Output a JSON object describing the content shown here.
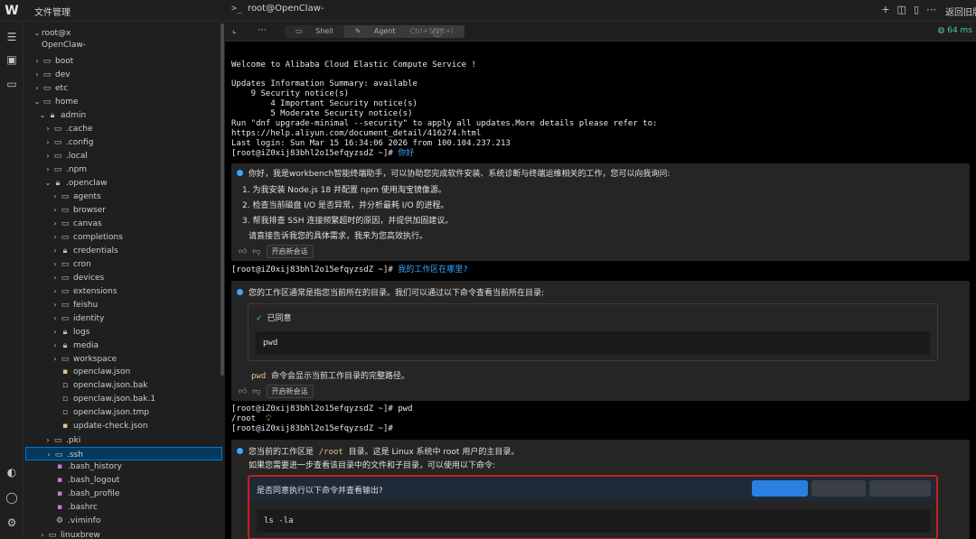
{
  "titlebar": {
    "app_title": "文件管理",
    "terminal_tab": "root@OpenClaw-",
    "back_label": "返回旧版"
  },
  "explorer": {
    "root_label": "root@x",
    "host_label": "OpenClaw-",
    "items": [
      {
        "label": "boot"
      },
      {
        "label": "dev"
      },
      {
        "label": "etc"
      },
      {
        "label": "home"
      },
      {
        "label": "admin"
      },
      {
        "label": ".cache"
      },
      {
        "label": ".config"
      },
      {
        "label": ".local"
      },
      {
        "label": ".npm"
      },
      {
        "label": ".openclaw"
      },
      {
        "label": "agents"
      },
      {
        "label": "browser"
      },
      {
        "label": "canvas"
      },
      {
        "label": "completions"
      },
      {
        "label": "credentials"
      },
      {
        "label": "cron"
      },
      {
        "label": "devices"
      },
      {
        "label": "extensions"
      },
      {
        "label": "feishu"
      },
      {
        "label": "identity"
      },
      {
        "label": "logs"
      },
      {
        "label": "media"
      },
      {
        "label": "workspace"
      },
      {
        "label": "openclaw.json"
      },
      {
        "label": "openclaw.json.bak"
      },
      {
        "label": "openclaw.json.bak.1"
      },
      {
        "label": "openclaw.json.tmp"
      },
      {
        "label": "update-check.json"
      },
      {
        "label": ".pki"
      },
      {
        "label": ".ssh"
      },
      {
        "label": ".bash_history"
      },
      {
        "label": ".bash_logout"
      },
      {
        "label": ".bash_profile"
      },
      {
        "label": ".bashrc"
      },
      {
        "label": ".viminfo"
      },
      {
        "label": "linuxbrew"
      }
    ]
  },
  "terminal": {
    "tabs": {
      "shell": "Shell",
      "agent": "Agent",
      "agent_kbd": "Ctrl+Shift+I"
    },
    "latency": "64 ms",
    "welcome": "Welcome to Alibaba Cloud Elastic Compute Service !",
    "updates": [
      "Updates Information Summary: available",
      "    9 Security notice(s)",
      "        4 Important Security notice(s)",
      "        5 Moderate Security notice(s)",
      "Run \"dnf upgrade-minimal --security\" to apply all updates.More details please refer to:",
      "https://help.aliyun.com/document_detail/416274.html",
      "Last login: Sun Mar 15 16:34:06 2026 from 100.104.237.213"
    ],
    "prompt": "[root@iZ0xij83bhl2o15efqyzsdZ ~]#",
    "cmd1": "你好",
    "cmd2": "我的工作区在哪里?",
    "cmd3": "pwd",
    "pwd_out": "/root",
    "ai1": {
      "intro": "你好，我是workbench智能终端助手，可以协助您完成软件安装、系统诊断与终端运维相关的工作，您可以向我询问:",
      "items": [
        "1. 为我安装 Node.js 18 并配置 npm 使用淘宝镜像源。",
        "2. 检查当前磁盘 I/O 是否异常，并分析最耗 I/O 的进程。",
        "3. 帮我排查 SSH 连接频繁超时的原因，并提供加固建议。"
      ],
      "outro": "请直接告诉我您的具体需求，我来为您高效执行。",
      "new_chat": "开启新会话"
    },
    "ai2": {
      "intro": "您的工作区通常是指您当前所在的目录。我们可以通过以下命令查看当前所在目录:",
      "agreed": "已同意",
      "code": "pwd",
      "note_code": "pwd",
      "note": "命令会显示当前工作目录的完整路径。",
      "new_chat": "开启新会话"
    },
    "ai3": {
      "intro_a": "您当前的工作区是",
      "intro_code": "/root",
      "intro_b": "目录。这是 Linux 系统中 root 用户的主目录。",
      "line2": "如果您需要进一步查看该目录中的文件和子目录，可以使用以下命令:",
      "confirm": "是否同意执行以下命令并查看输出?",
      "code": "ls -la"
    }
  }
}
